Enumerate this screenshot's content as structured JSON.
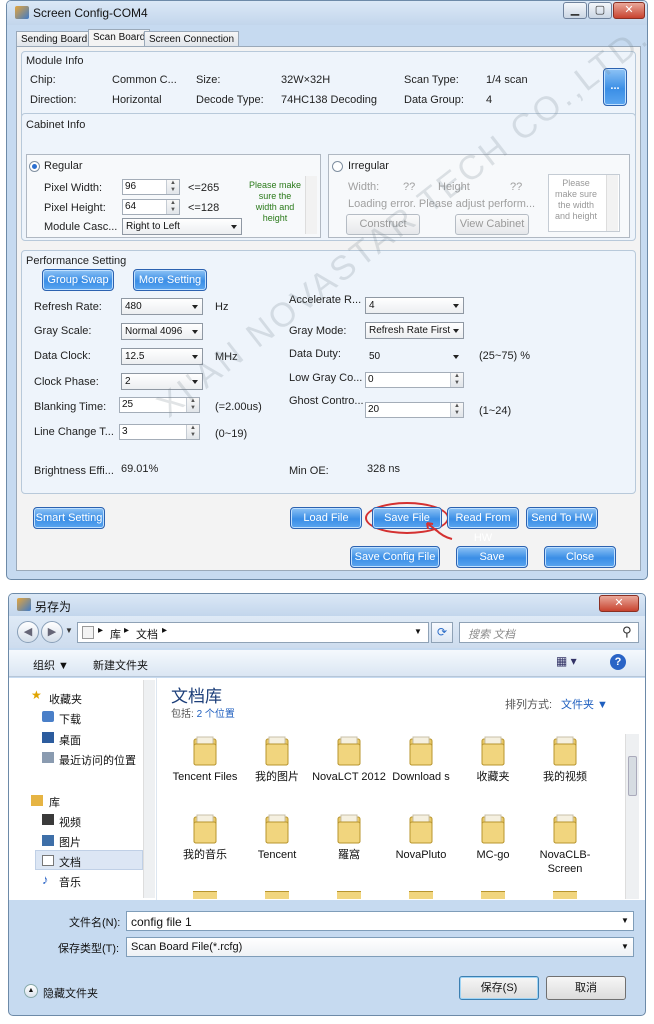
{
  "win1": {
    "title": "Screen Config-COM4",
    "tabs": [
      "Sending Board",
      "Scan Board",
      "Screen Connection"
    ],
    "module_info": {
      "label": "Module Info",
      "chip_label": "Chip:",
      "chip_value": "Common C...",
      "size_label": "Size:",
      "size_value": "32W×32H",
      "scan_type_label": "Scan Type:",
      "scan_type_value": "1/4 scan",
      "direction_label": "Direction:",
      "direction_value": "Horizontal",
      "decode_label": "Decode Type:",
      "decode_value": "74HC138 Decoding",
      "data_group_label": "Data Group:",
      "data_group_value": "4",
      "more_button": "..."
    },
    "cabinet_info": {
      "label": "Cabinet Info",
      "regular_label": "Regular",
      "pixel_width_label": "Pixel Width:",
      "pixel_width_value": "96",
      "pixel_width_hint": "<=265",
      "pixel_height_label": "Pixel Height:",
      "pixel_height_value": "64",
      "pixel_height_hint": "<=128",
      "module_casc_label": "Module Casc...",
      "module_casc_value": "Right to Left",
      "note_regular": "Please make sure the width and height",
      "irregular_label": "Irregular",
      "irr_width_label": "Width:",
      "irr_width_value": "??",
      "irr_height_label": "Height",
      "irr_height_value": "??",
      "irr_error": "Loading error. Please adjust perform...",
      "construct_button": "Construct",
      "view_cabinet_button": "View Cabinet",
      "note_irregular": "Please make sure the width and height"
    },
    "performance": {
      "label": "Performance Setting",
      "group_swap_button": "Group Swap",
      "more_setting_button": "More Setting",
      "refresh_rate_label": "Refresh Rate:",
      "refresh_rate_value": "480",
      "refresh_rate_unit": "Hz",
      "gray_scale_label": "Gray Scale:",
      "gray_scale_value": "Normal 4096",
      "data_clock_label": "Data Clock:",
      "data_clock_value": "12.5",
      "data_clock_unit": "MHz",
      "clock_phase_label": "Clock Phase:",
      "clock_phase_value": "2",
      "blanking_label": "Blanking Time:",
      "blanking_value": "25",
      "blanking_hint": "(=2.00us)",
      "line_change_label": "Line Change T...",
      "line_change_value": "3",
      "line_change_hint": "(0~19)",
      "brightness_label": "Brightness Effi...",
      "brightness_value": "69.01%",
      "accelerate_label": "Accelerate R...",
      "accelerate_value": "4",
      "gray_mode_label": "Gray Mode:",
      "gray_mode_value": "Refresh Rate First",
      "data_duty_label": "Data Duty:",
      "data_duty_value": "50",
      "data_duty_hint": "(25~75) %",
      "low_gray_label": "Low Gray Co...",
      "low_gray_value": "0",
      "ghost_label": "Ghost Contro...",
      "ghost_value": "20",
      "ghost_hint": "(1~24)",
      "min_oe_label": "Min OE:",
      "min_oe_value": "328 ns"
    },
    "actions": {
      "smart_setting": "Smart Setting",
      "load_file": "Load File",
      "save_file": "Save File",
      "read_from_hw": "Read From HW",
      "send_to_hw": "Send To HW",
      "save_config_file": "Save Config File",
      "save": "Save",
      "close": "Close"
    }
  },
  "watermark": "XI'AN NOVASTAR TECH CO.,LTD.",
  "win2": {
    "title": "另存为",
    "breadcrumb": [
      "库",
      "文档"
    ],
    "search_placeholder": "搜索 文档",
    "toolbar": {
      "organize": "组织 ▼",
      "new_folder": "新建文件夹"
    },
    "nav": {
      "favorites": "收藏夹",
      "fav_items": [
        "下载",
        "桌面",
        "最近访问的位置"
      ],
      "libraries": "库",
      "lib_items": [
        "视频",
        "图片",
        "文档",
        "音乐"
      ]
    },
    "library_title": "文档库",
    "library_sub": "包括: ",
    "library_locations": "2 个位置",
    "sort_label": "排列方式:",
    "sort_value": "文件夹 ▼",
    "folders": [
      "Tencent Files",
      "我的图片",
      "NovaLCT 2012",
      "Download s",
      "收藏夹",
      "我的视频",
      "我的音乐",
      "Tencent",
      "羅窩",
      "NovaPluto",
      "MC-go",
      "NovaCLB-Screen"
    ],
    "filename_label": "文件名(N):",
    "filename_value": "config file 1",
    "filetype_label": "保存类型(T):",
    "filetype_value": "Scan Board File(*.rcfg)",
    "hide_folders": "隐藏文件夹",
    "save_button": "保存(S)",
    "cancel_button": "取消"
  }
}
